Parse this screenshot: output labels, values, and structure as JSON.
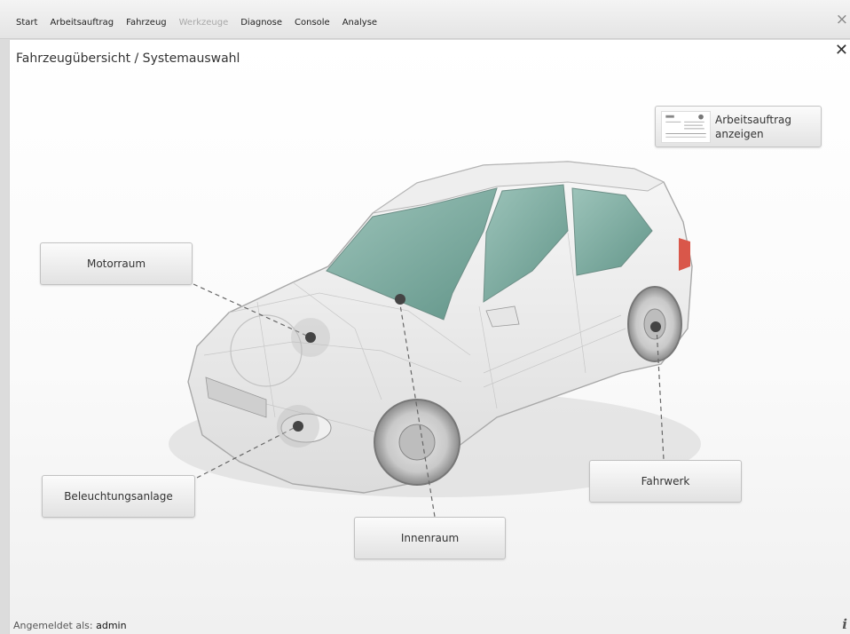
{
  "menu": {
    "items": [
      {
        "label": "Start",
        "enabled": true
      },
      {
        "label": "Arbeitsauftrag",
        "enabled": true
      },
      {
        "label": "Fahrzeug",
        "enabled": true
      },
      {
        "label": "Werkzeuge",
        "enabled": false
      },
      {
        "label": "Diagnose",
        "enabled": true
      },
      {
        "label": "Console",
        "enabled": true
      },
      {
        "label": "Analyse",
        "enabled": true
      }
    ],
    "close_glyph": "×"
  },
  "panel": {
    "title": "Fahrzeugübersicht / Systemauswahl",
    "close_glyph": "✕"
  },
  "workorder_button": {
    "line1": "Arbeitsauftrag",
    "line2": "anzeigen"
  },
  "areas": {
    "motorraum": "Motorraum",
    "beleuchtung": "Beleuchtungsanlage",
    "innenraum": "Innenraum",
    "fahrwerk": "Fahrwerk"
  },
  "footer": {
    "logged_in_label": "Angemeldet als:",
    "user": "admin",
    "info_glyph": "i"
  },
  "colors": {
    "glass": "#5e9c8e",
    "hotspot": "#444444"
  }
}
